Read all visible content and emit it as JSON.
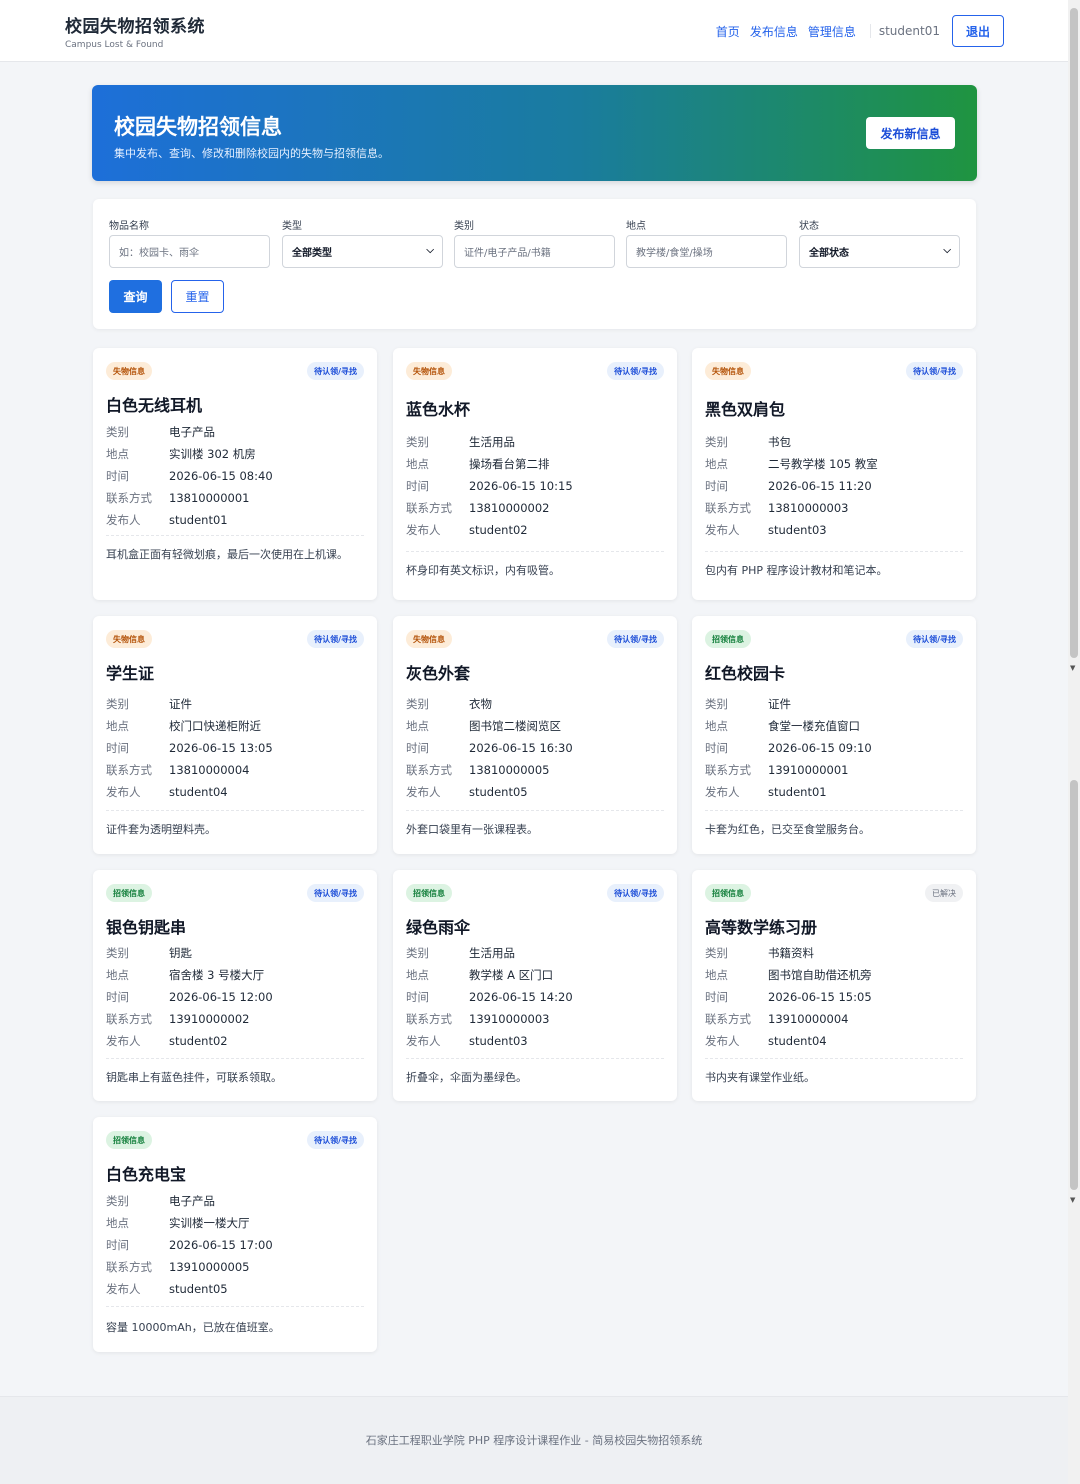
{
  "header": {
    "title": "校园失物招领系统",
    "subtitle": "Campus Lost & Found",
    "nav": [
      "首页",
      "发布信息",
      "管理信息"
    ],
    "user": "student01",
    "logout": "退出"
  },
  "banner": {
    "title": "校园失物招领信息",
    "desc": "集中发布、查询、修改和删除校园内的失物与招领信息。",
    "publish_button": "发布新信息"
  },
  "filter": {
    "name_label": "物品名称",
    "name_placeholder": "如：校园卡、雨伞",
    "type_label": "类型",
    "type_value": "全部类型",
    "category_label": "类别",
    "category_placeholder": "证件/电子产品/书籍",
    "location_label": "地点",
    "location_placeholder": "教学楼/食堂/操场",
    "status_label": "状态",
    "status_value": "全部状态",
    "query_button": "查询",
    "reset_button": "重置"
  },
  "field_labels": {
    "category": "类别",
    "location": "地点",
    "time": "时间",
    "contact": "联系方式",
    "publisher": "发布人"
  },
  "cards": [
    {
      "tag": "失物信息",
      "kind": "lost",
      "status": "待认领/寻找",
      "title": "白色无线耳机",
      "category": "电子产品",
      "location": "实训楼 302 机房",
      "time": "2026-06-15 08:40",
      "contact": "13810000001",
      "publisher": "student01",
      "desc": "耳机盒正面有轻微划痕，最后一次使用在上机课。"
    },
    {
      "tag": "失物信息",
      "kind": "lost",
      "status": "待认领/寻找",
      "title": "蓝色水杯",
      "category": "生活用品",
      "location": "操场看台第二排",
      "time": "2026-06-15 10:15",
      "contact": "13810000002",
      "publisher": "student02",
      "desc": "杯身印有英文标识，内有吸管。"
    },
    {
      "tag": "失物信息",
      "kind": "lost",
      "status": "待认领/寻找",
      "title": "黑色双肩包",
      "category": "书包",
      "location": "二号教学楼 105 教室",
      "time": "2026-06-15 11:20",
      "contact": "13810000003",
      "publisher": "student03",
      "desc": "包内有 PHP 程序设计教材和笔记本。"
    },
    {
      "tag": "失物信息",
      "kind": "lost",
      "status": "待认领/寻找",
      "title": "学生证",
      "category": "证件",
      "location": "校门口快递柜附近",
      "time": "2026-06-15 13:05",
      "contact": "13810000004",
      "publisher": "student04",
      "desc": "证件套为透明塑料壳。"
    },
    {
      "tag": "失物信息",
      "kind": "lost",
      "status": "待认领/寻找",
      "title": "灰色外套",
      "category": "衣物",
      "location": "图书馆二楼阅览区",
      "time": "2026-06-15 16:30",
      "contact": "13810000005",
      "publisher": "student05",
      "desc": "外套口袋里有一张课程表。"
    },
    {
      "tag": "招领信息",
      "kind": "found",
      "status": "待认领/寻找",
      "title": "红色校园卡",
      "category": "证件",
      "location": "食堂一楼充值窗口",
      "time": "2026-06-15 09:10",
      "contact": "13910000001",
      "publisher": "student01",
      "desc": "卡套为红色，已交至食堂服务台。"
    },
    {
      "tag": "招领信息",
      "kind": "found",
      "status": "待认领/寻找",
      "title": "银色钥匙串",
      "category": "钥匙",
      "location": "宿舍楼 3 号楼大厅",
      "time": "2026-06-15 12:00",
      "contact": "13910000002",
      "publisher": "student02",
      "desc": "钥匙串上有蓝色挂件，可联系领取。"
    },
    {
      "tag": "招领信息",
      "kind": "found",
      "status": "待认领/寻找",
      "title": "绿色雨伞",
      "category": "生活用品",
      "location": "教学楼 A 区门口",
      "time": "2026-06-15 14:20",
      "contact": "13910000003",
      "publisher": "student03",
      "desc": "折叠伞，伞面为墨绿色。"
    },
    {
      "tag": "招领信息",
      "kind": "found",
      "status": "已解决",
      "title": "高等数学练习册",
      "category": "书籍资料",
      "location": "图书馆自助借还机旁",
      "time": "2026-06-15 15:05",
      "contact": "13910000004",
      "publisher": "student04",
      "desc": "书内夹有课堂作业纸。"
    },
    {
      "tag": "招领信息",
      "kind": "found",
      "status": "待认领/寻找",
      "title": "白色充电宝",
      "category": "电子产品",
      "location": "实训楼一楼大厅",
      "time": "2026-06-15 17:00",
      "contact": "13910000005",
      "publisher": "student05",
      "desc": "容量 10000mAh，已放在值班室。"
    }
  ],
  "footer": {
    "text": "石家庄工程职业学院 PHP 程序设计课程作业 - 简易校园失物招领系统"
  }
}
